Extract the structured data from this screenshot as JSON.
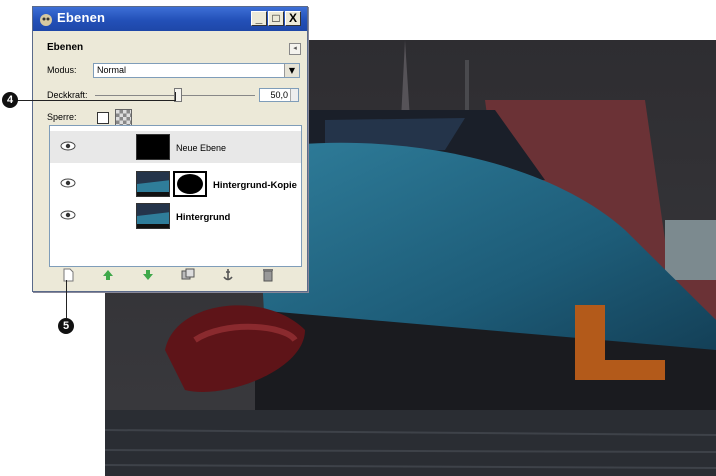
{
  "window": {
    "title": "Ebenen",
    "buttons": {
      "minimize": "_",
      "maximize": "□",
      "close": "X"
    }
  },
  "panel": {
    "title": "Ebenen",
    "mode_label": "Modus:",
    "mode_value": "Normal",
    "opacity_label": "Deckkraft:",
    "opacity_value": "50,0",
    "opacity_fraction": 0.5,
    "lock_label": "Sperre:"
  },
  "layers": [
    {
      "name": "Neue Ebene",
      "selected": true,
      "has_mask": false
    },
    {
      "name": "Hintergrund-Kopie",
      "selected": false,
      "has_mask": true
    },
    {
      "name": "Hintergrund",
      "selected": false,
      "has_mask": false
    }
  ],
  "bottom_buttons": [
    "new-layer-icon",
    "raise-layer-icon",
    "lower-layer-icon",
    "duplicate-layer-icon",
    "anchor-layer-icon",
    "delete-layer-icon"
  ],
  "callouts": {
    "opacity": "4",
    "new_layer": "5"
  },
  "colors": {
    "titlebar": "#2350b8",
    "panel": "#ece9d8",
    "arrows": "#3fa84a"
  }
}
